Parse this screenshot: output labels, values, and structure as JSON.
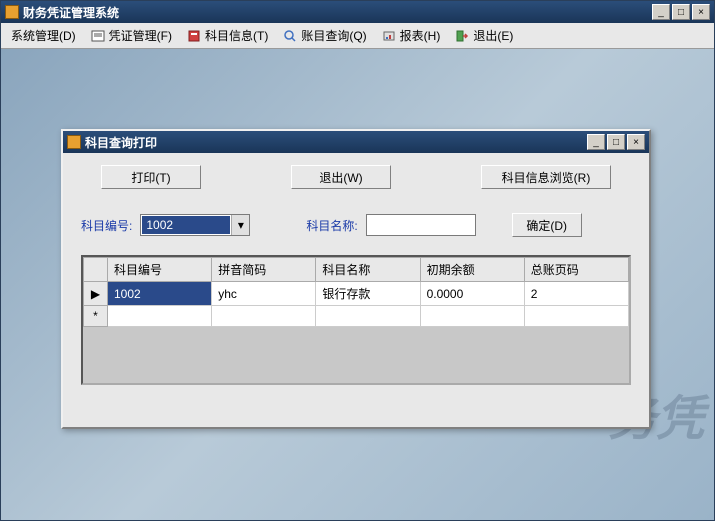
{
  "app": {
    "title": "财务凭证管理系统"
  },
  "menu": {
    "system": "系统管理(D)",
    "voucher": "凭证管理(F)",
    "subject": "科目信息(T)",
    "account_query": "账目查询(Q)",
    "report": "报表(H)",
    "exit": "退出(E)"
  },
  "dialog": {
    "title": "科目查询打印",
    "buttons": {
      "print": "打印(T)",
      "exit": "退出(W)",
      "browse": "科目信息浏览(R)",
      "confirm": "确定(D)"
    },
    "labels": {
      "subject_code": "科目编号:",
      "subject_name": "科目名称:"
    },
    "fields": {
      "subject_code_value": "1002",
      "subject_name_value": ""
    },
    "grid": {
      "headers": {
        "code": "科目编号",
        "pinyin": "拼音简码",
        "name": "科目名称",
        "opening_balance": "初期余额",
        "ledger_page": "总账页码"
      },
      "rows": [
        {
          "indicator": "▶",
          "code": "1002",
          "pinyin": "yhc",
          "name": "银行存款",
          "opening_balance": "0.0000",
          "ledger_page": "2"
        }
      ],
      "new_row_indicator": "*"
    }
  },
  "watermark": "务凭"
}
